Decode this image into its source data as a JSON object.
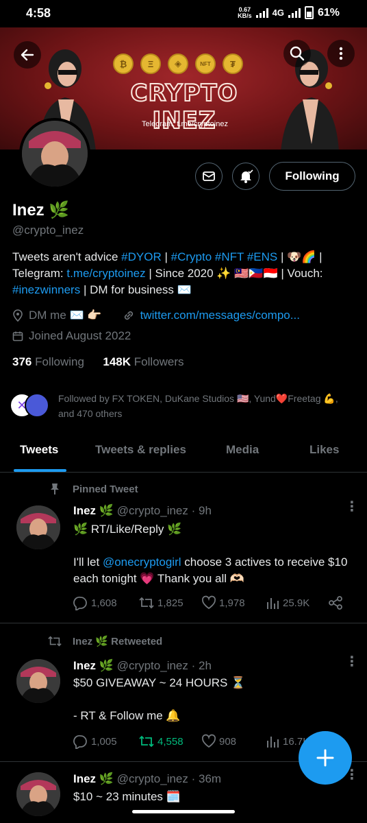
{
  "status": {
    "time": "4:58",
    "speed": "0.67",
    "speed_unit": "KB/s",
    "network": "4G",
    "battery": "61%"
  },
  "banner": {
    "brand": "CRYPTO INEZ",
    "telegram": "Telegram: t.me/cryptoinez",
    "coins": [
      "₿",
      "Ξ",
      "◈",
      "NFT",
      "₮"
    ]
  },
  "profile": {
    "name": "Inez 🌿",
    "handle": "@crypto_inez",
    "following_button": "Following",
    "bio": {
      "p1": "Tweets aren't advice ",
      "tag_dyor": "#DYOR",
      "p2": " | ",
      "tag_crypto": "#Crypto",
      "p3": " ",
      "tag_nft": "#NFT",
      "p4": " ",
      "tag_ens": "#ENS",
      "p5": " | 🐶🌈 | Telegram: ",
      "link_tg": "t.me/cryptoinez",
      "p6": " | Since 2020 ✨ 🇲🇾🇵🇭🇮🇩 | Vouch: ",
      "tag_winners": "#inezwinners",
      "p7": " | DM for business ✉️"
    },
    "location": "DM me ✉️ 👉🏻",
    "website": "twitter.com/messages/compo...",
    "joined": "Joined August 2022",
    "following_count": "376",
    "following_label": "Following",
    "followers_count": "148K",
    "followers_label": "Followers",
    "followed_by": "Followed by FX TOKEN, DuKane Studios 🇺🇸, Yund❤️Freetag 💪, and 470 others"
  },
  "tabs": [
    "Tweets",
    "Tweets & replies",
    "Media",
    "Likes"
  ],
  "tweets": [
    {
      "context": "Pinned Tweet",
      "name": "Inez 🌿",
      "handle": "@crypto_inez",
      "time": "· 9h",
      "line1": "🌿 RT/Like/Reply 🌿",
      "line2a": "I'll let ",
      "mention": "@onecryptogirl",
      "line2b": " choose 3 actives to receive $10 each tonight 💗 Thank you all 🫶🏻",
      "replies": "1,608",
      "retweets": "1,825",
      "likes": "1,978",
      "views": "25.9K"
    },
    {
      "context": "Inez 🌿 Retweeted",
      "name": "Inez 🌿",
      "handle": "@crypto_inez",
      "time": "· 2h",
      "line1": "$50 GIVEAWAY ~ 24 HOURS ⏳",
      "line2": "- RT & Follow me 🔔",
      "replies": "1,005",
      "retweets": "4,558",
      "likes": "908",
      "views": "16.7K"
    },
    {
      "name": "Inez 🌿",
      "handle": "@crypto_inez",
      "time": "· 36m",
      "line1": "$10 ~ 23 minutes 🗓️"
    }
  ],
  "colors": {
    "accent": "#1d9bf0",
    "retweet_green": "#00ba7c",
    "muted": "#71767b",
    "banner_red": "#8e1c1d"
  }
}
